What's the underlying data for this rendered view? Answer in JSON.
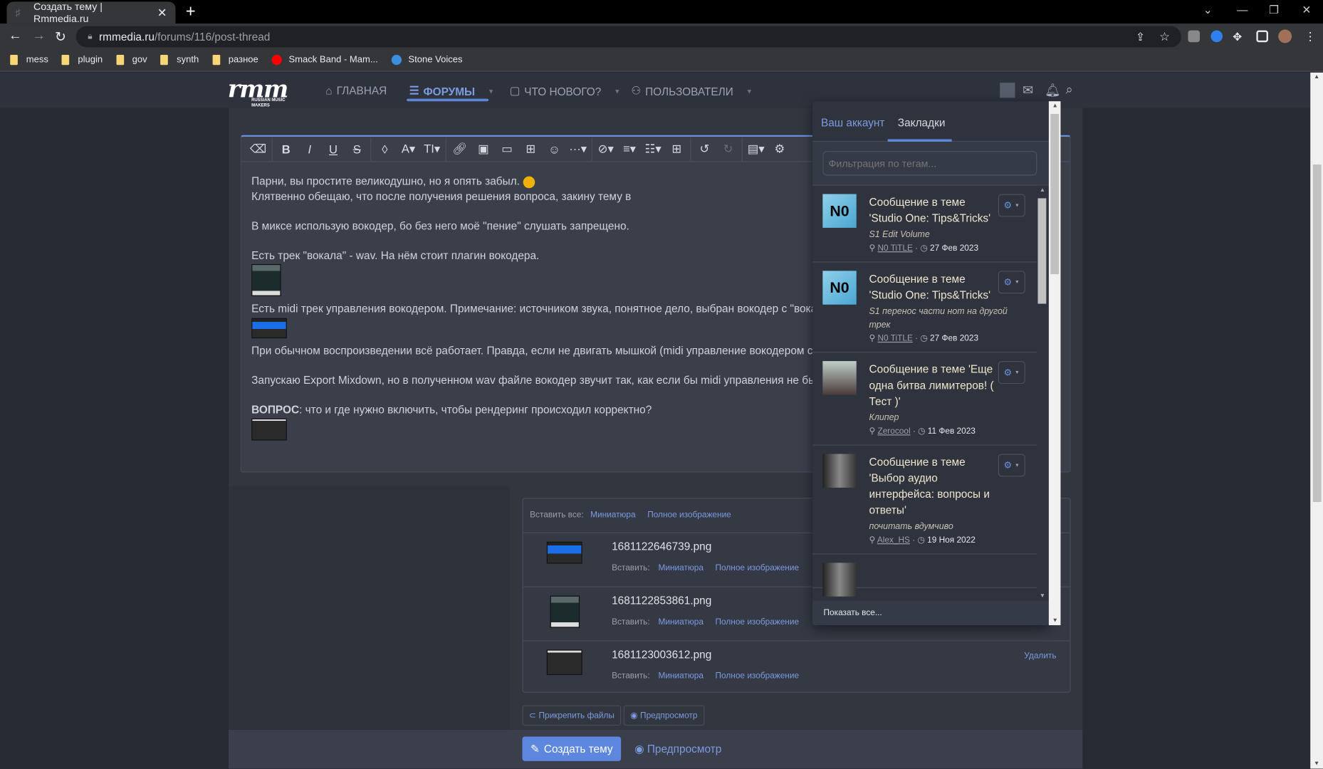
{
  "browser": {
    "tab_title": "Создать тему | Rmmedia.ru",
    "url_host": "rmmedia.ru",
    "url_path": "/forums/116/post-thread",
    "bookmarks": [
      {
        "label": "mess",
        "icon": "folder-icon"
      },
      {
        "label": "plugin",
        "icon": "folder-icon"
      },
      {
        "label": "gov",
        "icon": "folder-icon"
      },
      {
        "label": "synth",
        "icon": "folder-icon"
      },
      {
        "label": "разное",
        "icon": "folder-icon"
      },
      {
        "label": "Smack Band - Mam...",
        "icon": "youtube-music-icon"
      },
      {
        "label": "Stone Voices",
        "icon": "waveform-icon"
      }
    ]
  },
  "site": {
    "logo": "rmm",
    "logo_sub": "RUSSIAN MUSIC MAKERS",
    "nav": [
      {
        "label": "ГЛАВНАЯ",
        "icon": "home-icon"
      },
      {
        "label": "ФОРУМЫ",
        "icon": "forum-icon",
        "active": true
      },
      {
        "label": "ЧТО НОВОГО?",
        "icon": "comment-icon"
      },
      {
        "label": "ПОЛЬЗОВАТЕЛИ",
        "icon": "users-icon"
      }
    ]
  },
  "editor": {
    "toolbar": [
      "eraser",
      "bold",
      "italic",
      "underline",
      "strikethrough",
      "color",
      "font",
      "font-size",
      "link",
      "image",
      "video",
      "media",
      "emoji",
      "more",
      "hide",
      "align",
      "list",
      "table",
      "undo",
      "redo",
      "drafts",
      "settings"
    ],
    "lines": {
      "l1": "Парни, вы простите великодушно, но я опять забыл.",
      "l2": "Клятвенно обещаю, что после получения решения вопроса, закину тему в",
      "l3": "В миксе использую вокодер, бо без него моё \"пение\" слушать запрещено.",
      "l4": "Есть трек \"вокала\" - wav. На нём стоит плагин вокодера.",
      "l5": "Есть midi трек управления вокодером. Примечание: источником звука, понятное дело, выбран вокодер с \"вокалом\"",
      "l6": "При обычном воспроизведении всё работает. Правда, если не двигать мышкой (midi управление вокодером сразу",
      "l7": "Запускаю Export Mixdown, но в полученном wav файле вокодер звучит так, как если бы midi управления не было",
      "l8_bold": "ВОПРОС",
      "l8": ": что и где нужно включить, чтобы рендеринг происходил корректно?"
    }
  },
  "attachments": {
    "insert_all": "Вставить все:",
    "thumb": "Миниатюра",
    "full": "Полное изображение",
    "insert": "Вставить:",
    "delete": "Удалить",
    "files": [
      "1681122646739.png",
      "1681122853861.png",
      "1681123003612.png"
    ]
  },
  "actions": {
    "attach": "Прикрепить файлы",
    "preview": "Предпросмотр",
    "create": "Создать тему",
    "preview2": "Предпросмотр"
  },
  "dropdown": {
    "tab_account": "Ваш аккаунт",
    "tab_bookmarks": "Закладки",
    "filter_placeholder": "Фильтрация по тегам...",
    "show_all": "Показать все...",
    "items": [
      {
        "title": "Сообщение в теме 'Studio One: Tips&Tricks'",
        "note": "S1 Edit Volume",
        "user": "N0 TiTLE",
        "date": "27 Фев 2023",
        "avatar": "N0"
      },
      {
        "title": "Сообщение в теме 'Studio One: Tips&Tricks'",
        "note": "S1 перенос части нот на другой трек",
        "user": "N0 TiTLE",
        "date": "27 Фев 2023",
        "avatar": "N0"
      },
      {
        "title": "Сообщение в теме 'Еще одна битва лимитеров! ( Тест )'",
        "note": "Клипер",
        "user": "Zerocool",
        "date": "11 Фев 2023"
      },
      {
        "title": "Сообщение в теме 'Выбор аудио интерфейса: вопросы и ответы'",
        "note": "почитать вдумчиво",
        "user": "Alex_HS",
        "date": "19 Ноя 2022"
      }
    ]
  },
  "colors": {
    "accent": "#5f85d8",
    "link": "#7c9be0",
    "button": "#5d86de",
    "bg": "#31363f"
  }
}
